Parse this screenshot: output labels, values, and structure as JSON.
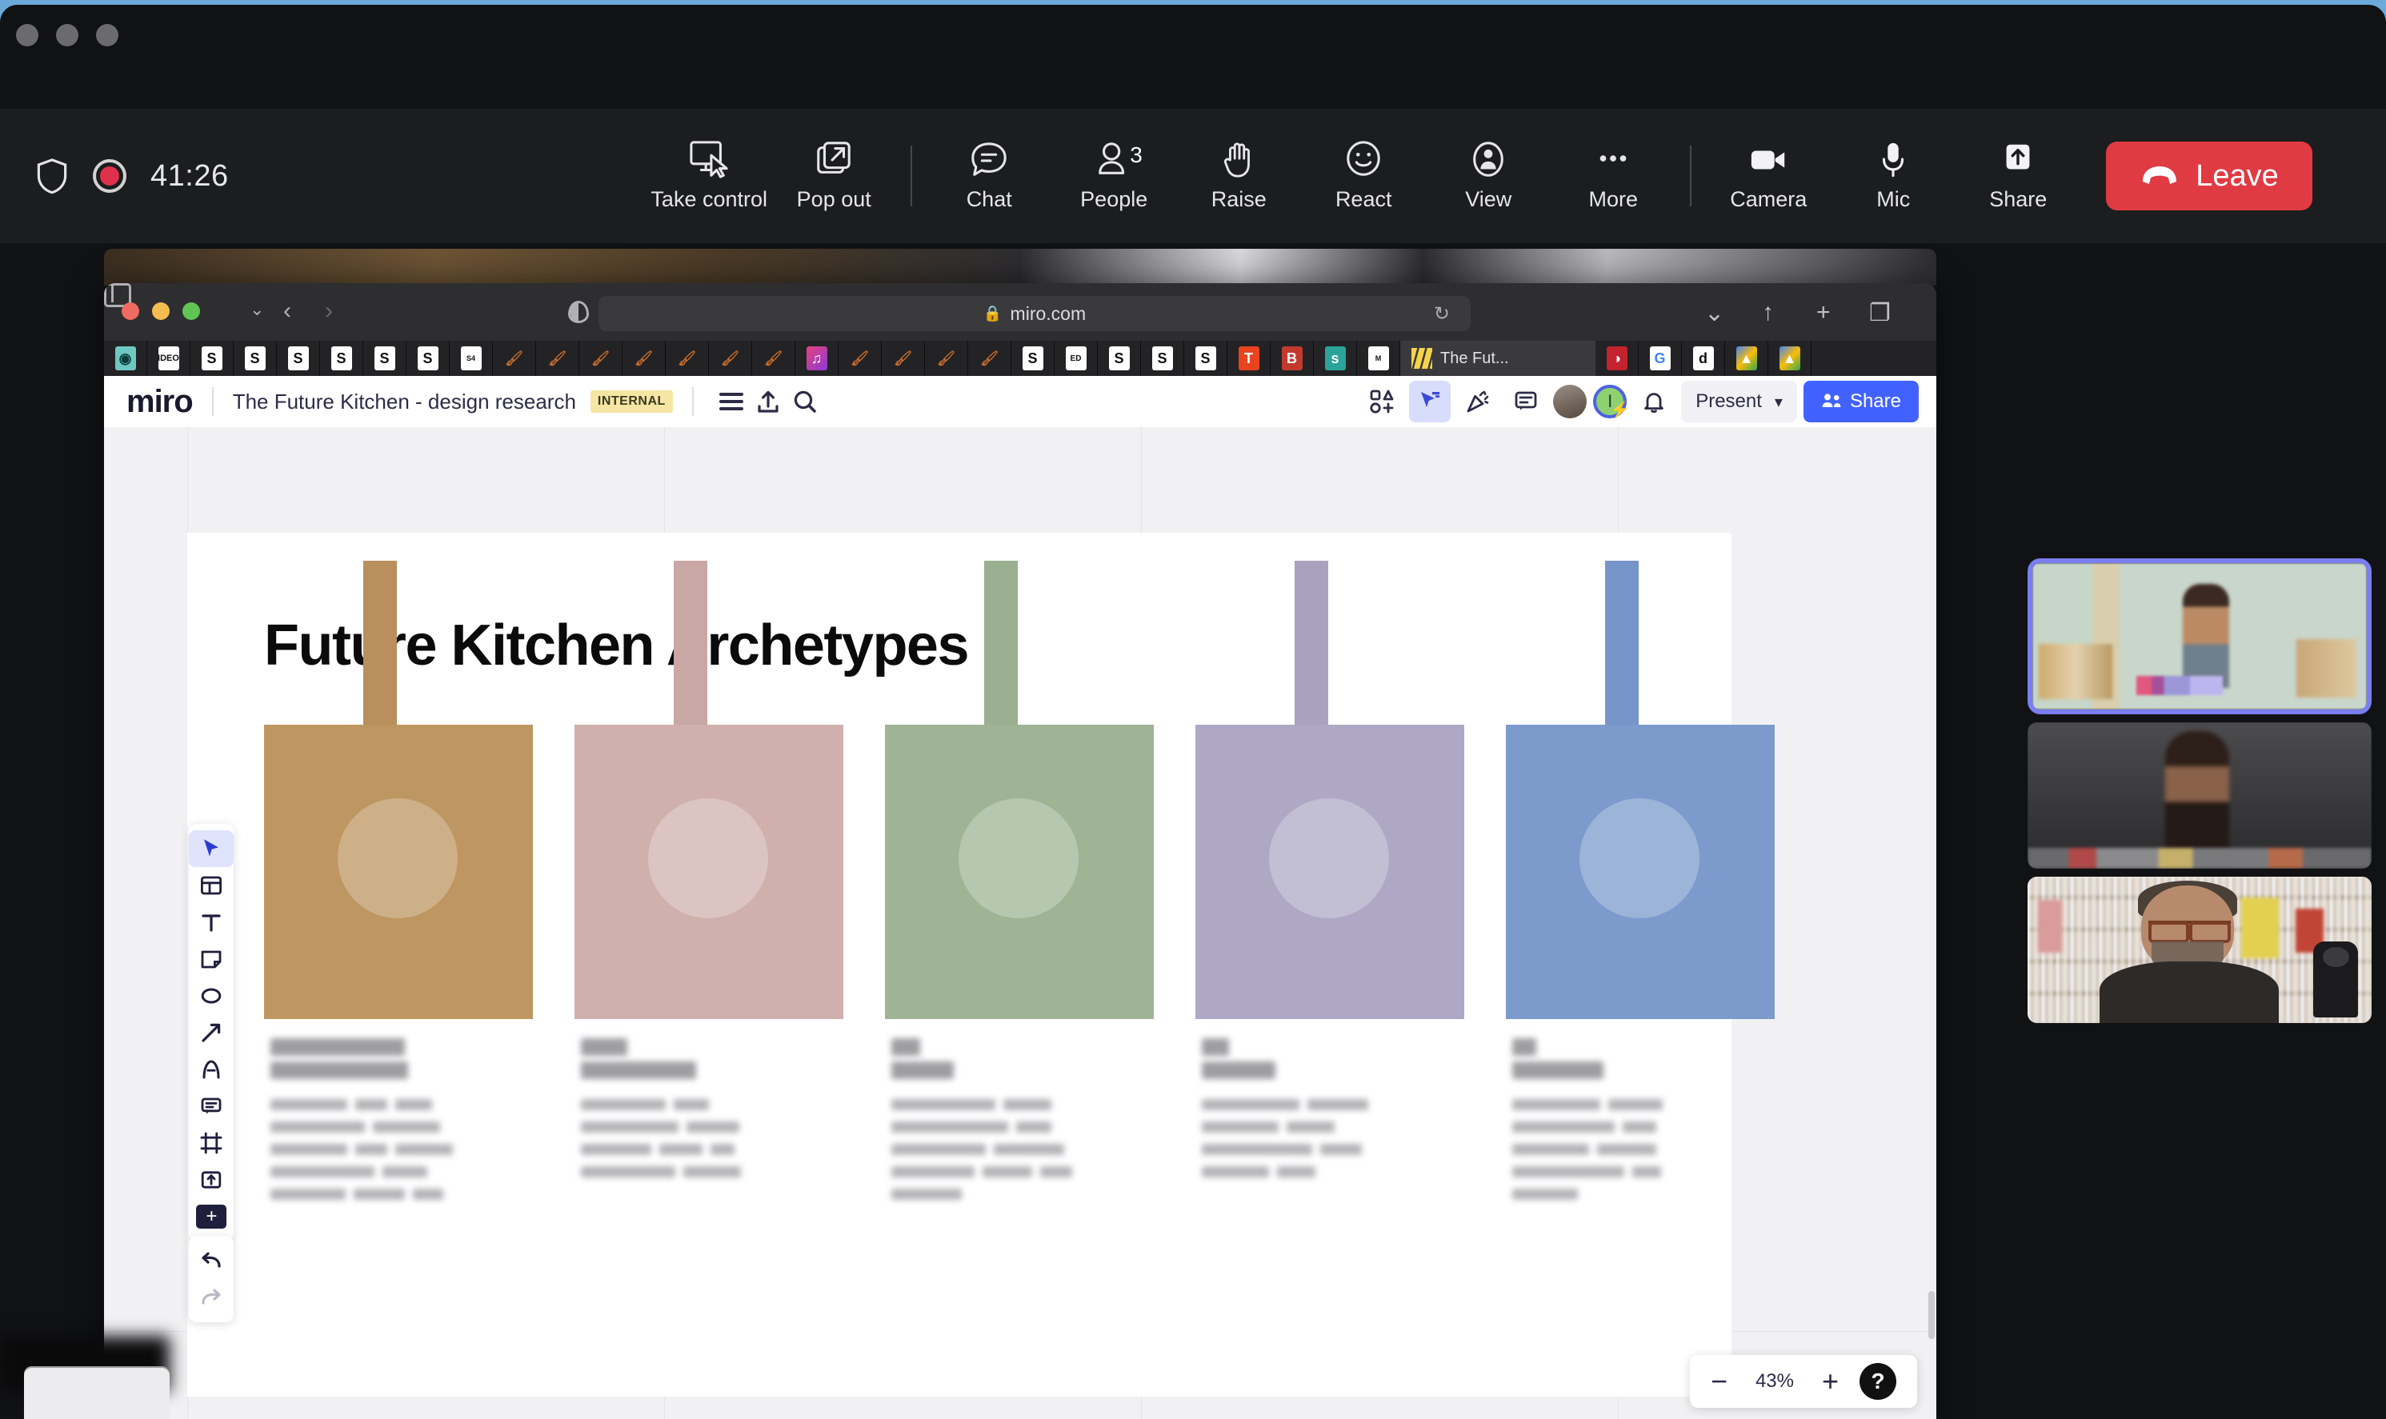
{
  "meeting": {
    "recording_timer": "41:26",
    "shield_icon": "shield-icon",
    "record_icon": "record-dot-icon",
    "toolbar_items": [
      {
        "id": "take-control",
        "label": "Take control",
        "icon": "monitor-cursor-icon"
      },
      {
        "id": "pop-out",
        "label": "Pop out",
        "icon": "pop-out-icon"
      },
      {
        "id": "chat",
        "label": "Chat",
        "icon": "chat-bubble-icon"
      },
      {
        "id": "people",
        "label": "People",
        "icon": "person-icon",
        "count": "3"
      },
      {
        "id": "raise",
        "label": "Raise",
        "icon": "raised-hand-icon"
      },
      {
        "id": "react",
        "label": "React",
        "icon": "smiley-face-icon"
      },
      {
        "id": "view",
        "label": "View",
        "icon": "view-layout-icon"
      },
      {
        "id": "more",
        "label": "More",
        "icon": "ellipsis-icon"
      },
      {
        "id": "camera",
        "label": "Camera",
        "icon": "video-camera-icon"
      },
      {
        "id": "mic",
        "label": "Mic",
        "icon": "microphone-icon"
      },
      {
        "id": "share",
        "label": "Share",
        "icon": "share-up-arrow-icon"
      }
    ],
    "leave_label": "Leave",
    "leave_color": "#e03a42",
    "leave_icon": "phone-hangup-icon"
  },
  "safari": {
    "url": "miro.com",
    "lock_icon": "lock-icon",
    "reload_icon": "reload-icon",
    "back_icon": "chevron-left-icon",
    "forward_icon": "chevron-right-icon",
    "sidebar_icon": "sidebar-toggle-icon",
    "reader_icon": "reader-view-icon",
    "right_icons": [
      "downloads-icon",
      "share-icon",
      "new-tab-icon",
      "tab-overview-icon"
    ],
    "active_tab_label": "The Fut...",
    "favicons_left": [
      "fp",
      "IDEO",
      "S",
      "S",
      "S",
      "S",
      "S",
      "S",
      "S4"
    ],
    "favicons_mid": [
      "m",
      "S",
      "ED",
      "S",
      "S",
      "S",
      "T",
      "B",
      "s",
      "M"
    ],
    "favicons_right": [
      "c",
      "G",
      "d",
      "A",
      "A"
    ]
  },
  "miro": {
    "logo": "miro",
    "board_title": "The Future Kitchen - design research",
    "internal_badge": "INTERNAL",
    "header_icons": [
      "menu-icon",
      "upload-icon",
      "search-icon"
    ],
    "right_icons": [
      "shapes-grid-icon",
      "cursor-pointer-icon",
      "confetti-icon",
      "comment-list-icon"
    ],
    "bell_icon": "bell-icon",
    "present_label": "Present",
    "present_chevron": "chevron-down-icon",
    "share_label": "Share",
    "share_icon": "people-share-icon",
    "share_color": "#4262ff",
    "tools": [
      {
        "id": "select",
        "icon": "cursor-arrow-icon",
        "selected": true
      },
      {
        "id": "templates",
        "icon": "templates-icon",
        "selected": false
      },
      {
        "id": "text",
        "icon": "text-t-icon",
        "selected": false
      },
      {
        "id": "sticky",
        "icon": "sticky-note-icon",
        "selected": false
      },
      {
        "id": "shapes",
        "icon": "ellipse-shape-icon",
        "selected": false
      },
      {
        "id": "arrow",
        "icon": "arrow-connector-icon",
        "selected": false
      },
      {
        "id": "pen",
        "icon": "pen-draw-icon",
        "selected": false
      },
      {
        "id": "comment",
        "icon": "comment-icon",
        "selected": false
      },
      {
        "id": "frame",
        "icon": "frame-icon",
        "selected": false
      },
      {
        "id": "upload",
        "icon": "upload-box-icon",
        "selected": false
      },
      {
        "id": "more-apps",
        "icon": "plus-icon",
        "selected": false
      }
    ],
    "history_tools": [
      {
        "id": "undo",
        "icon": "undo-arrow-icon"
      },
      {
        "id": "redo",
        "icon": "redo-arrow-icon"
      }
    ],
    "zoom_level": "43%",
    "zoom_out_icon": "minus-icon",
    "zoom_in_icon": "plus-icon",
    "help_label": "?"
  },
  "board": {
    "heading": "Future Kitchen Archetypes",
    "archetypes": [
      {
        "id": "archetype-1",
        "color": "#be9661",
        "stem_color": "#b98f5d",
        "label_redacted": true,
        "label_widths": [
          168,
          172
        ],
        "body_widths": [
          [
            96,
            40,
            46
          ],
          [
            118,
            84
          ],
          [
            96,
            40,
            72
          ],
          [
            130,
            56
          ],
          [
            94,
            64,
            38
          ]
        ]
      },
      {
        "id": "archetype-2",
        "color": "#cfb0ad",
        "stem_color": "#c8a7a4",
        "label_redacted": true,
        "label_widths": [
          58,
          144
        ],
        "body_widths": [
          [
            106,
            44
          ],
          [
            122,
            66
          ],
          [
            88,
            54,
            30
          ],
          [
            118,
            72
          ]
        ]
      },
      {
        "id": "archetype-3",
        "color": "#9eb495",
        "stem_color": "#9aaf90",
        "label_redacted": true,
        "label_widths": [
          36,
          78
        ],
        "body_widths": [
          [
            130,
            60
          ],
          [
            146,
            44
          ],
          [
            118,
            88
          ],
          [
            104,
            62,
            40
          ],
          [
            88
          ]
        ]
      },
      {
        "id": "archetype-4",
        "color": "#aea8c4",
        "stem_color": "#a8a2bf",
        "label_redacted": true,
        "label_widths": [
          34,
          92
        ],
        "body_widths": [
          [
            122,
            76
          ],
          [
            96,
            60
          ],
          [
            138,
            52
          ],
          [
            84,
            48
          ]
        ]
      },
      {
        "id": "archetype-5",
        "color": "#7c9bcc",
        "stem_color": "#7795c8",
        "label_redacted": true,
        "label_widths": [
          30,
          114
        ],
        "body_widths": [
          [
            110,
            68
          ],
          [
            128,
            42
          ],
          [
            96,
            74
          ],
          [
            140,
            36
          ],
          [
            82
          ]
        ]
      }
    ]
  },
  "participants": [
    {
      "id": "participant-1",
      "speaking": true,
      "border_color": "#7b7ef0"
    },
    {
      "id": "participant-2",
      "speaking": false,
      "border_color": ""
    },
    {
      "id": "participant-3",
      "speaking": false,
      "border_color": ""
    }
  ]
}
